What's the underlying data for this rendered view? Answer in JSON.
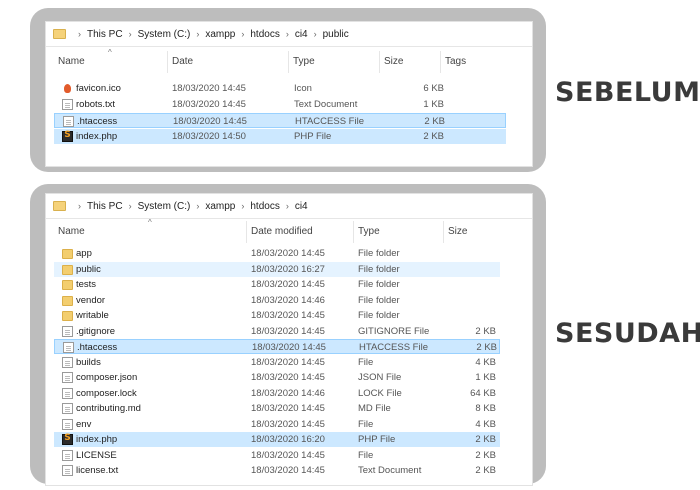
{
  "top": {
    "path": [
      "This PC",
      "System (C:)",
      "xampp",
      "htdocs",
      "ci4",
      "public"
    ],
    "columns": [
      "Name",
      "Date",
      "Type",
      "Size",
      "Tags"
    ],
    "files": [
      {
        "name": "favicon.ico",
        "date": "18/03/2020 14:45",
        "type": "Icon",
        "size": "6 KB",
        "icon": "favicon-icon",
        "state": ""
      },
      {
        "name": "robots.txt",
        "date": "18/03/2020 14:45",
        "type": "Text Document",
        "size": "1 KB",
        "icon": "text-file-icon",
        "state": ""
      },
      {
        "name": ".htaccess",
        "date": "18/03/2020 14:45",
        "type": "HTACCESS File",
        "size": "2 KB",
        "icon": "file-icon",
        "state": "selected-border"
      },
      {
        "name": "index.php",
        "date": "18/03/2020 14:50",
        "type": "PHP File",
        "size": "2 KB",
        "icon": "php-file-icon",
        "state": "selected"
      }
    ],
    "label": "SEBELUM"
  },
  "bottom": {
    "path": [
      "This PC",
      "System (C:)",
      "xampp",
      "htdocs",
      "ci4"
    ],
    "columns": [
      "Name",
      "Date modified",
      "Type",
      "Size"
    ],
    "files": [
      {
        "name": "app",
        "date": "18/03/2020 14:45",
        "type": "File folder",
        "size": "",
        "icon": "folder-icon",
        "state": ""
      },
      {
        "name": "public",
        "date": "18/03/2020 16:27",
        "type": "File folder",
        "size": "",
        "icon": "folder-icon",
        "state": "hover"
      },
      {
        "name": "tests",
        "date": "18/03/2020 14:45",
        "type": "File folder",
        "size": "",
        "icon": "folder-icon",
        "state": ""
      },
      {
        "name": "vendor",
        "date": "18/03/2020 14:46",
        "type": "File folder",
        "size": "",
        "icon": "folder-icon",
        "state": ""
      },
      {
        "name": "writable",
        "date": "18/03/2020 14:45",
        "type": "File folder",
        "size": "",
        "icon": "folder-icon",
        "state": ""
      },
      {
        "name": ".gitignore",
        "date": "18/03/2020 14:45",
        "type": "GITIGNORE File",
        "size": "2 KB",
        "icon": "file-icon",
        "state": ""
      },
      {
        "name": ".htaccess",
        "date": "18/03/2020 14:45",
        "type": "HTACCESS File",
        "size": "2 KB",
        "icon": "file-icon",
        "state": "selected-border"
      },
      {
        "name": "builds",
        "date": "18/03/2020 14:45",
        "type": "File",
        "size": "4 KB",
        "icon": "file-icon",
        "state": ""
      },
      {
        "name": "composer.json",
        "date": "18/03/2020 14:45",
        "type": "JSON File",
        "size": "1 KB",
        "icon": "file-icon",
        "state": ""
      },
      {
        "name": "composer.lock",
        "date": "18/03/2020 14:46",
        "type": "LOCK File",
        "size": "64 KB",
        "icon": "file-icon",
        "state": ""
      },
      {
        "name": "contributing.md",
        "date": "18/03/2020 14:45",
        "type": "MD File",
        "size": "8 KB",
        "icon": "file-icon",
        "state": ""
      },
      {
        "name": "env",
        "date": "18/03/2020 14:45",
        "type": "File",
        "size": "4 KB",
        "icon": "file-icon",
        "state": ""
      },
      {
        "name": "index.php",
        "date": "18/03/2020 16:20",
        "type": "PHP File",
        "size": "2 KB",
        "icon": "php-file-icon",
        "state": "selected"
      },
      {
        "name": "LICENSE",
        "date": "18/03/2020 14:45",
        "type": "File",
        "size": "2 KB",
        "icon": "file-icon",
        "state": ""
      },
      {
        "name": "license.txt",
        "date": "18/03/2020 14:45",
        "type": "Text Document",
        "size": "2 KB",
        "icon": "text-file-icon",
        "state": ""
      }
    ],
    "label": "SESUDAH"
  },
  "colors": {
    "selected": "#cce8ff",
    "selected_border": "#99d1ff",
    "hover": "#e5f3ff",
    "panel": "#bdbdbd"
  }
}
